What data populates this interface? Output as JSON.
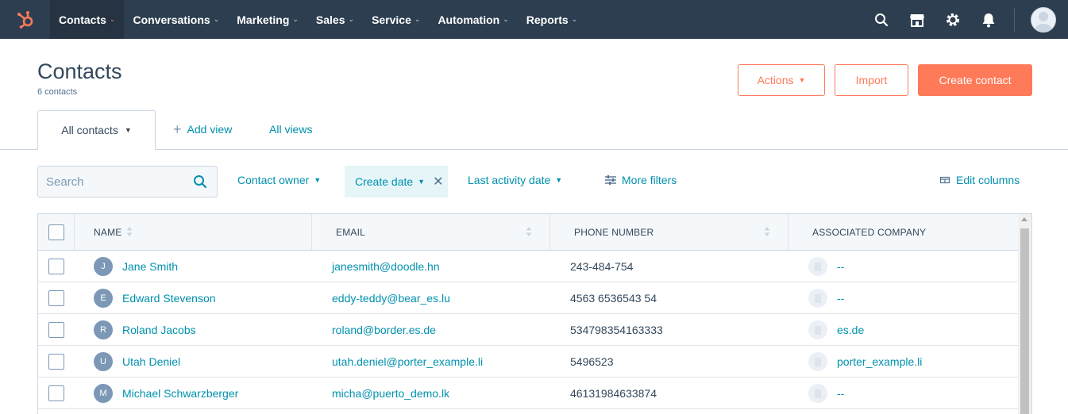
{
  "nav": {
    "items": [
      {
        "label": "Contacts",
        "active": true
      },
      {
        "label": "Conversations"
      },
      {
        "label": "Marketing"
      },
      {
        "label": "Sales"
      },
      {
        "label": "Service"
      },
      {
        "label": "Automation"
      },
      {
        "label": "Reports"
      }
    ],
    "icons": [
      "search-icon",
      "marketplace-icon",
      "gear-icon",
      "bell-icon",
      "avatar"
    ],
    "colors": {
      "bg": "#2d3e50",
      "active_bg": "#253342",
      "accent": "#ff7a59"
    }
  },
  "header": {
    "title": "Contacts",
    "subtitle": "6 contacts",
    "actions_label": "Actions",
    "import_label": "Import",
    "create_label": "Create contact"
  },
  "tabs": {
    "active_label": "All contacts",
    "add_view_label": "Add view",
    "all_views_label": "All views"
  },
  "filters": {
    "search_placeholder": "Search",
    "contact_owner": "Contact owner",
    "create_date": "Create date",
    "last_activity": "Last activity date",
    "more_filters": "More filters",
    "edit_columns": "Edit columns"
  },
  "table": {
    "columns": [
      "NAME",
      "EMAIL",
      "PHONE NUMBER",
      "ASSOCIATED COMPANY"
    ],
    "rows": [
      {
        "initial": "J",
        "name": "Jane Smith",
        "email": "janesmith@doodle.hn",
        "phone": "243-484-754",
        "company": "--"
      },
      {
        "initial": "E",
        "name": "Edward Stevenson",
        "email": "eddy-teddy@bear_es.lu",
        "phone": "4563 6536543 54",
        "company": "--"
      },
      {
        "initial": "R",
        "name": "Roland Jacobs",
        "email": "roland@border.es.de",
        "phone": "534798354163333",
        "company": "es.de"
      },
      {
        "initial": "U",
        "name": "Utah Deniel",
        "email": "utah.deniel@porter_example.li",
        "phone": "5496523",
        "company": "porter_example.li"
      },
      {
        "initial": "M",
        "name": "Michael Schwarzberger",
        "email": "micha@puerto_demo.lk",
        "phone": "46131984633874",
        "company": "--"
      }
    ]
  }
}
